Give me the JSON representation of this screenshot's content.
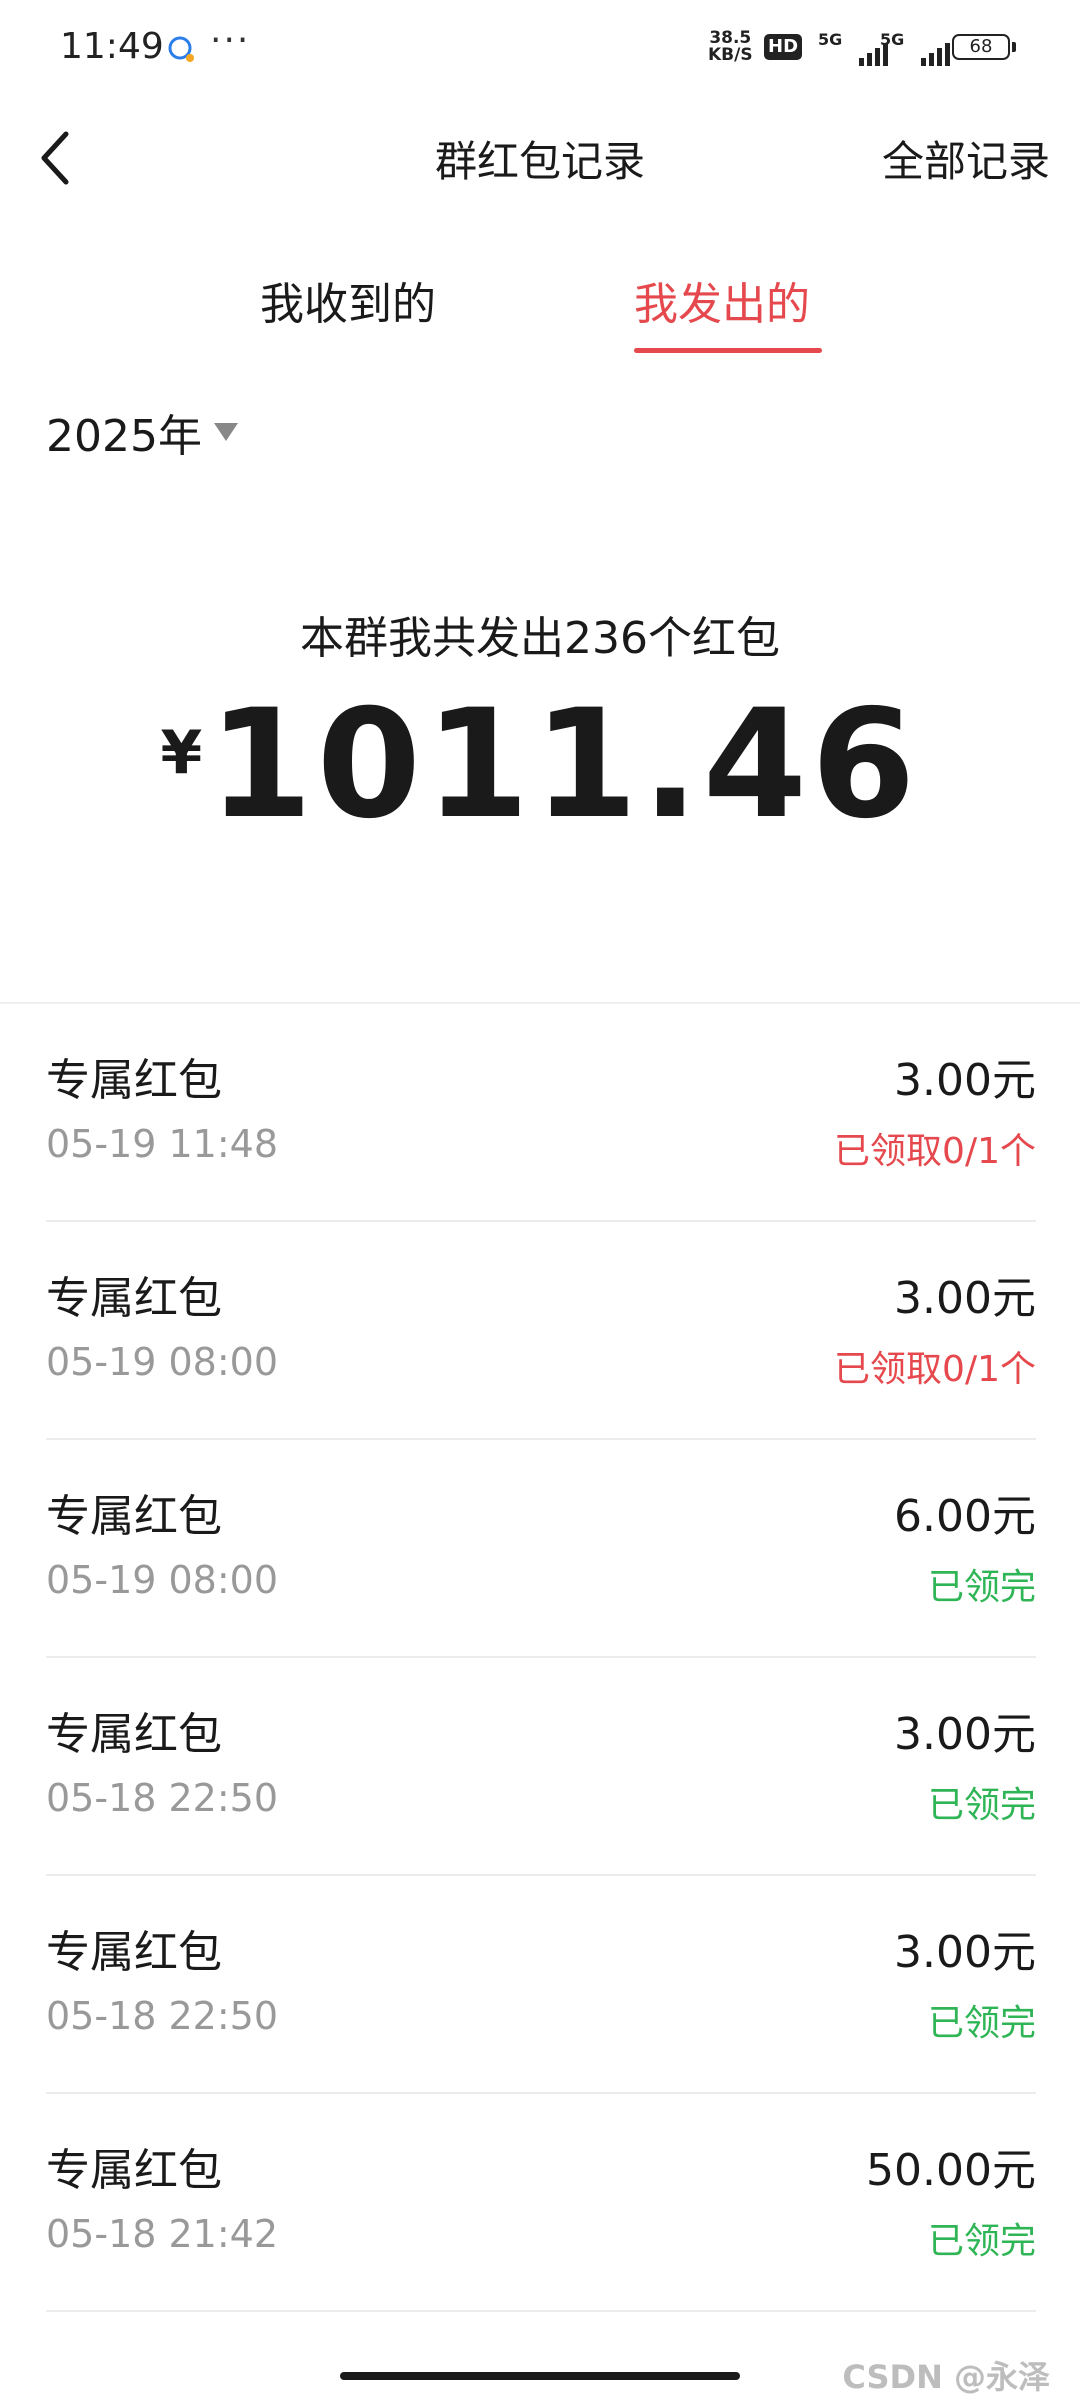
{
  "status_bar": {
    "time": "11:49",
    "dots": "···",
    "speed_value": "38.5",
    "speed_unit": "KB/S",
    "hd": "HD",
    "net1": "5G",
    "net2": "5G",
    "battery": "68",
    "chat_icon": "chat-bubble-icon"
  },
  "header": {
    "back_icon": "chevron-left-icon",
    "title": "群红包记录",
    "right_link": "全部记录"
  },
  "tabs": [
    {
      "label": "我收到的",
      "active": false
    },
    {
      "label": "我发出的",
      "active": true
    }
  ],
  "year": {
    "label": "2025年",
    "caret_icon": "caret-down-icon"
  },
  "summary": {
    "text": "本群我共发出236个红包",
    "currency": "¥",
    "amount": "1011.46"
  },
  "records": [
    {
      "title": "专属红包",
      "time": "05-19 11:48",
      "amount": "3.00元",
      "status": "已领取0/1个",
      "status_color": "#e5484d"
    },
    {
      "title": "专属红包",
      "time": "05-19 08:00",
      "amount": "3.00元",
      "status": "已领取0/1个",
      "status_color": "#e5484d"
    },
    {
      "title": "专属红包",
      "time": "05-19 08:00",
      "amount": "6.00元",
      "status": "已领完",
      "status_color": "#2fb556"
    },
    {
      "title": "专属红包",
      "time": "05-18 22:50",
      "amount": "3.00元",
      "status": "已领完",
      "status_color": "#2fb556"
    },
    {
      "title": "专属红包",
      "time": "05-18 22:50",
      "amount": "3.00元",
      "status": "已领完",
      "status_color": "#2fb556"
    },
    {
      "title": "专属红包",
      "time": "05-18 21:42",
      "amount": "50.00元",
      "status": "已领完",
      "status_color": "#2fb556"
    }
  ],
  "watermark": "CSDN @永泽",
  "colors": {
    "accent_red": "#e5484d",
    "status_green": "#2fb556"
  }
}
